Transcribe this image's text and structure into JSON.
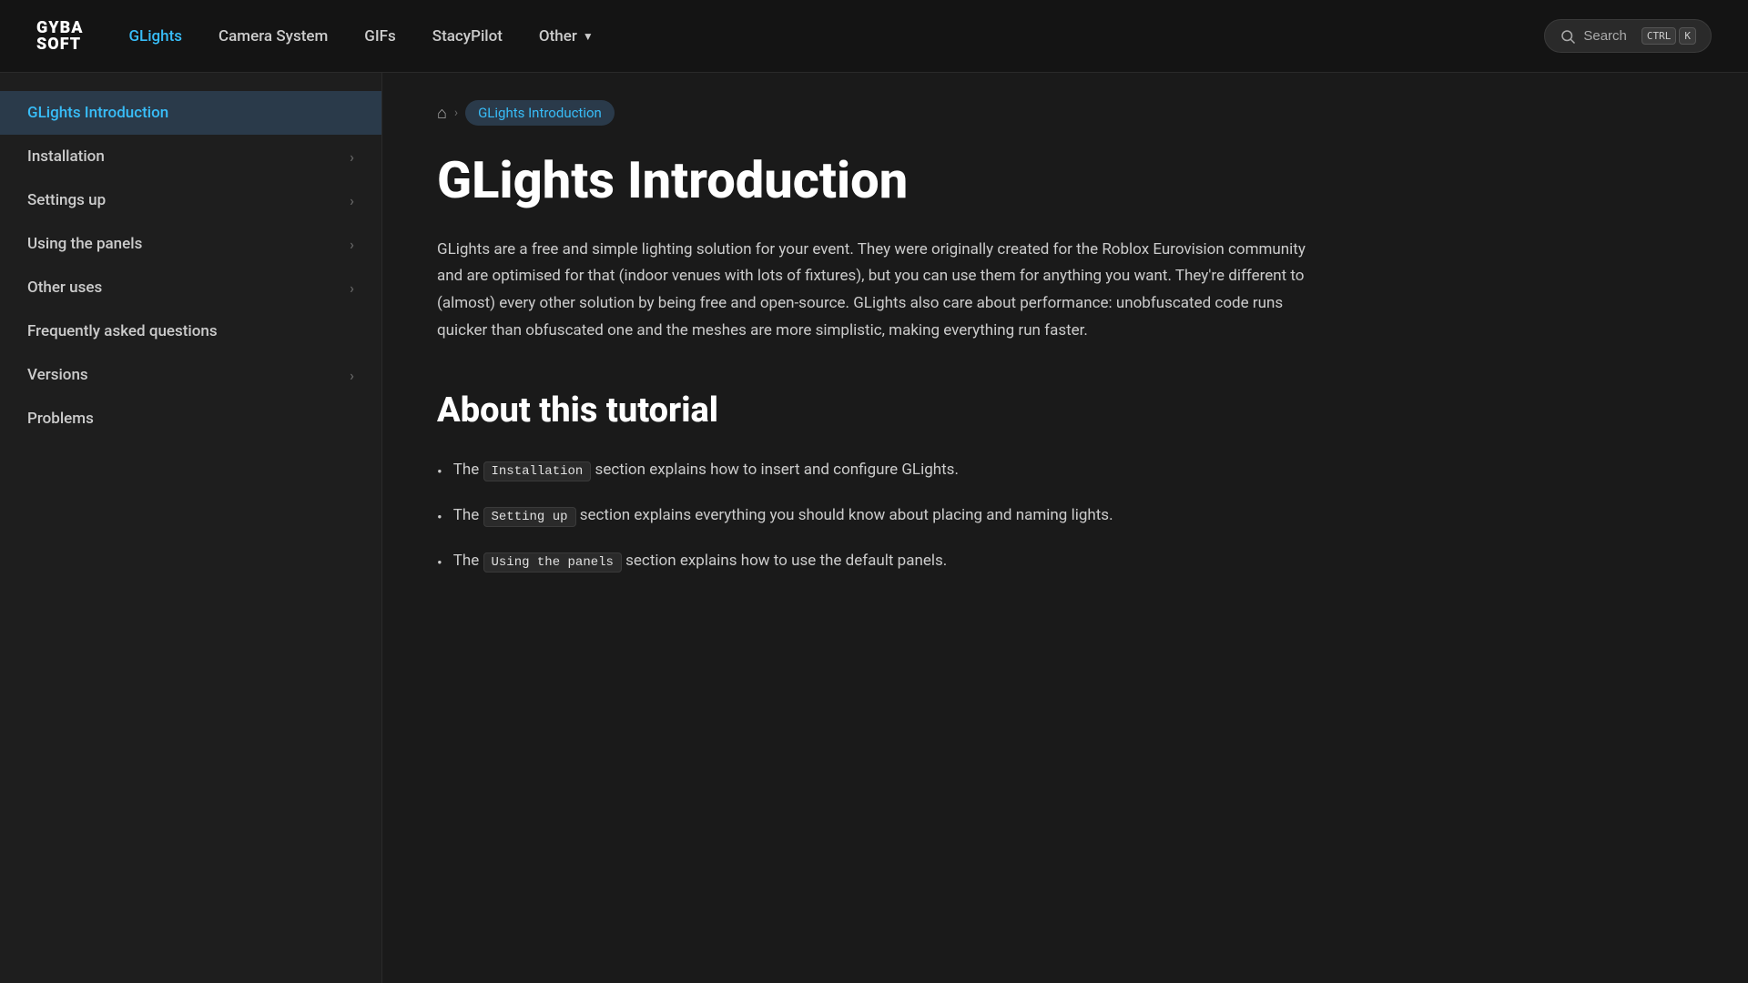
{
  "brand": {
    "name_line1": "GYBA",
    "name_line2": "SOFT"
  },
  "topnav": {
    "links": [
      {
        "label": "GLights",
        "active": true
      },
      {
        "label": "Camera System",
        "active": false
      },
      {
        "label": "GIFs",
        "active": false
      },
      {
        "label": "StacyPilot",
        "active": false
      },
      {
        "label": "Other",
        "active": false,
        "hasDropdown": true
      }
    ],
    "search_label": "Search",
    "kbd1": "CTRL",
    "kbd2": "K"
  },
  "sidebar": {
    "items": [
      {
        "label": "GLights Introduction",
        "active": true,
        "hasChevron": false
      },
      {
        "label": "Installation",
        "active": false,
        "hasChevron": true
      },
      {
        "label": "Settings up",
        "active": false,
        "hasChevron": true
      },
      {
        "label": "Using the panels",
        "active": false,
        "hasChevron": true
      },
      {
        "label": "Other uses",
        "active": false,
        "hasChevron": true
      },
      {
        "label": "Frequently asked questions",
        "active": false,
        "hasChevron": false
      },
      {
        "label": "Versions",
        "active": false,
        "hasChevron": true
      },
      {
        "label": "Problems",
        "active": false,
        "hasChevron": false
      }
    ]
  },
  "breadcrumb": {
    "current": "GLights Introduction"
  },
  "page": {
    "title": "GLights Introduction",
    "intro": "GLights are a free and simple lighting solution for your event. They were originally created for the Roblox Eurovision community and are optimised for that (indoor venues with lots of fixtures), but you can use them for anything you want. They're different to (almost) every other solution by being free and open-source. GLights also care about performance: unobfuscated code runs quicker than obfuscated one and the meshes are more simplistic, making everything run faster.",
    "section_title": "About this tutorial",
    "bullets": [
      {
        "prefix": "The",
        "code": "Installation",
        "suffix": "section explains how to insert and configure GLights."
      },
      {
        "prefix": "The",
        "code": "Setting up",
        "suffix": "section explains everything you should know about placing and naming lights."
      },
      {
        "prefix": "The",
        "code": "Using the panels",
        "suffix": "section explains how to use the default panels."
      }
    ]
  }
}
